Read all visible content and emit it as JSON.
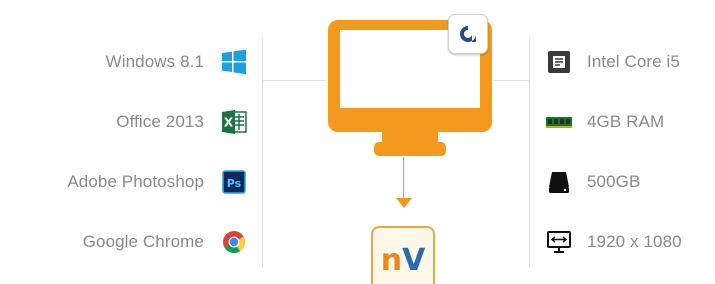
{
  "left_items": [
    {
      "label": "Windows 8.1",
      "icon": "windows-icon"
    },
    {
      "label": "Office 2013",
      "icon": "excel-icon"
    },
    {
      "label": "Adobe Photoshop",
      "icon": "photoshop-icon"
    },
    {
      "label": "Google Chrome",
      "icon": "chrome-icon"
    }
  ],
  "right_items": [
    {
      "label": "Intel Core i5",
      "icon": "cpu-icon"
    },
    {
      "label": "4GB RAM",
      "icon": "ram-icon"
    },
    {
      "label": "500GB",
      "icon": "hard-drive-icon"
    },
    {
      "label": "1920 x 1080",
      "icon": "resolution-icon"
    }
  ],
  "monitor": {
    "icon": "monitor-icon",
    "color": "#f39a1e",
    "badge_icon": "app-logo-icon"
  },
  "nv_badge": {
    "text_n": "n",
    "text_v": "V"
  },
  "colors": {
    "orange": "#f39a1e",
    "text": "#8a8a8a",
    "windows_blue": "#1ba1e2",
    "excel_green": "#1e7145",
    "photoshop_blue": "#0a2a5c"
  }
}
